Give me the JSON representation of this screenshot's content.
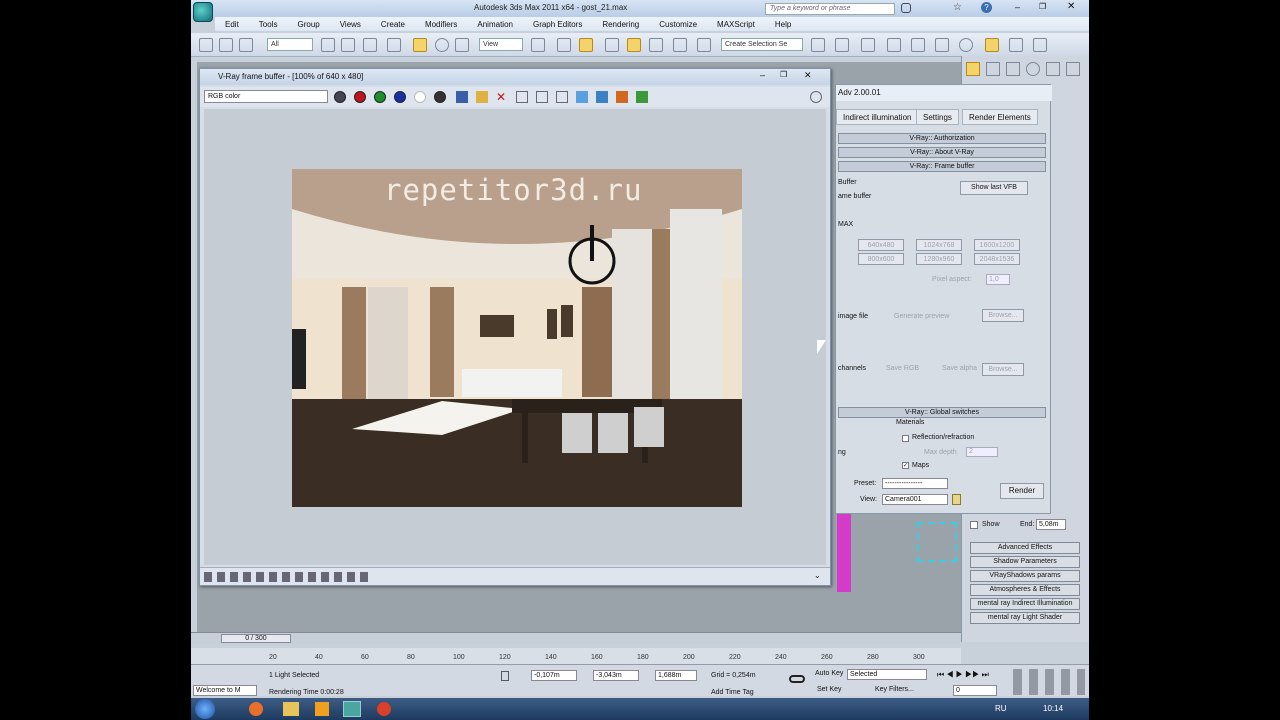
{
  "app": {
    "title": "Autodesk 3ds Max  2011 x64 - gost_21.max",
    "search_placeholder": "Type a keyword or phrase",
    "menu": [
      "Edit",
      "Tools",
      "Group",
      "Views",
      "Create",
      "Modifiers",
      "Animation",
      "Graph Editors",
      "Rendering",
      "Customize",
      "MAXScript",
      "Help"
    ],
    "selection_filter": "All",
    "ref_coord": "View",
    "named_selection": "Create Selection Se"
  },
  "vfb": {
    "title": "V-Ray frame buffer - [100% of 640 x 480]",
    "channel": "RGB color",
    "watermark": "repetitor3d.ru"
  },
  "render_setup": {
    "title": "Adv 2.00.01",
    "tabs": [
      "Indirect illumination",
      "Settings",
      "Render Elements"
    ],
    "rollouts": [
      "V-Ray:: Authorization",
      "V-Ray:: About V-Ray",
      "V-Ray:: Frame buffer"
    ],
    "fb_labels": [
      "Buffer",
      "ame buffer",
      "MAX"
    ],
    "show_last_vfb": "Show last VFB",
    "res_buttons": [
      "640x480",
      "1024x768",
      "1600x1200",
      "800x600",
      "1280x960",
      "2048x1536"
    ],
    "pixel_aspect_label": "Pixel aspect:",
    "pixel_aspect_value": "1,0",
    "image_file_label": "image file",
    "generate_preview": "Generate preview",
    "browse": "Browse...",
    "channels_label": "channels",
    "save_rgb": "Save RGB",
    "save_alpha": "Save alpha",
    "global_switches": "V-Ray:: Global switches",
    "materials_label": "Materials",
    "reflection_refraction": "Reflection/refraction",
    "max_depth_label": "Max depth",
    "max_depth_value": "2",
    "maps_label": "Maps",
    "ng_label": "ng",
    "preset_label": "Preset:",
    "preset_value": "----------------",
    "view_label": "View:",
    "view_value": "Camera001",
    "render_button": "Render"
  },
  "command_panel": {
    "show_label": "Show",
    "end_label": "End:",
    "end_value": "5,08m",
    "rollouts": [
      "Advanced Effects",
      "Shadow Parameters",
      "VRayShadows params",
      "Atmospheres & Effects",
      "mental ray Indirect Illumination",
      "mental ray Light Shader"
    ]
  },
  "timeline": {
    "frame": "0 / 300",
    "ticks": [
      "20",
      "40",
      "60",
      "80",
      "100",
      "120",
      "140",
      "160",
      "180",
      "200",
      "220",
      "240",
      "260",
      "280",
      "300"
    ]
  },
  "status": {
    "maxscript": "Welcome to M",
    "selection": "1 Light Selected",
    "rendering_time": "Rendering Time  0:00:28",
    "x": "-0,107m",
    "y": "-3,043m",
    "z": "1,688m",
    "grid": "Grid = 0,254m",
    "add_time_tag": "Add Time Tag",
    "auto_key": "Auto Key",
    "set_key": "Set Key",
    "key_mode": "Selected",
    "key_filters": "Key Filters...",
    "frame_field": "0"
  },
  "taskbar": {
    "lang": "RU",
    "clock": "10:14"
  }
}
